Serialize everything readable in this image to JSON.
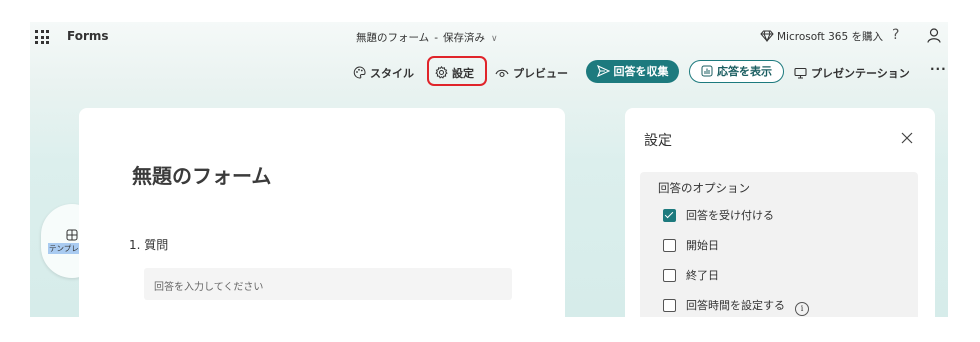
{
  "topbar": {
    "app_name": "Forms",
    "doc_title": "無題のフォーム",
    "separator": "-",
    "save_status": "保存済み",
    "buy_label": "Microsoft 365 を購入",
    "help_label": "?"
  },
  "toolbar": {
    "style_label": "スタイル",
    "settings_label": "設定",
    "preview_label": "プレビュー",
    "collect_label": "回答を収集",
    "show_responses_label": "応答を表示",
    "present_label": "プレゼンテーション",
    "more_label": "···"
  },
  "form": {
    "title": "無題のフォーム",
    "question_label": "1. 質問",
    "answer_placeholder": "回答を入力してください"
  },
  "template": {
    "label": "テンプレート"
  },
  "settings_panel": {
    "title": "設定",
    "section_title": "回答のオプション",
    "options": [
      {
        "label": "回答を受け付ける",
        "checked": true
      },
      {
        "label": "開始日",
        "checked": false
      },
      {
        "label": "終了日",
        "checked": false
      },
      {
        "label": "回答時間を設定する",
        "checked": false
      }
    ],
    "info_glyph": "i"
  },
  "colors": {
    "accent": "#1d7a7e",
    "highlight": "#e0242a"
  }
}
